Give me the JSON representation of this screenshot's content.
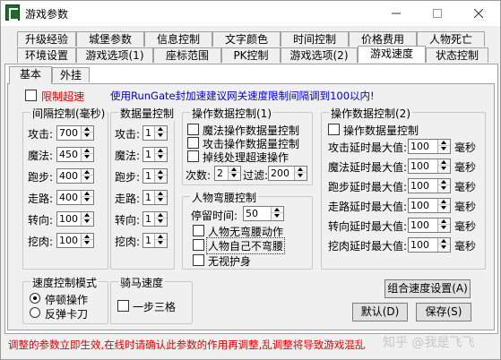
{
  "window": {
    "title": "游戏参数",
    "minimize": "—",
    "maximize": "□",
    "close": "✕"
  },
  "tabs_row1": [
    "升级经验",
    "城堡参数",
    "信息控制",
    "文字颜色",
    "时间控制",
    "价格费用",
    "人物死亡"
  ],
  "tabs_row2": [
    "环境设置",
    "游戏选项(1)",
    "座标范围",
    "PK控制",
    "游戏选项(2)",
    "游戏速度",
    "状态控制"
  ],
  "active_tab": "游戏速度",
  "subtabs": [
    "基本",
    "外挂"
  ],
  "limit_speed": {
    "label": "限制超速",
    "checked": false
  },
  "notice": "使用RunGate封加速建议网关速度限制间隔调到100以内!",
  "interval_group": {
    "title": "间隔控制(毫秒)",
    "rows": [
      {
        "label": "攻击:",
        "value": "700"
      },
      {
        "label": "魔法:",
        "value": "450"
      },
      {
        "label": "跑步:",
        "value": "400"
      },
      {
        "label": "走路:",
        "value": "400"
      },
      {
        "label": "转向:",
        "value": "100"
      },
      {
        "label": "挖肉:",
        "value": "100"
      }
    ]
  },
  "count_group": {
    "title": "数据量控制",
    "rows": [
      {
        "label": "攻击:",
        "value": "1"
      },
      {
        "label": "魔法:",
        "value": "1"
      },
      {
        "label": "跑步:",
        "value": "1"
      },
      {
        "label": "走路:",
        "value": "1"
      },
      {
        "label": "转向:",
        "value": "1"
      },
      {
        "label": "挖肉:",
        "value": "1"
      }
    ]
  },
  "op1_group": {
    "title": "操作数据控制(1)",
    "checks": [
      "魔法操作数据量控制",
      "攻击操作数据量控制",
      "掉线处理超速操作"
    ],
    "count_label": "次数:",
    "count_value": "2",
    "filter_label": "过滤:",
    "filter_value": "200"
  },
  "bow_group": {
    "title": "人物弯腰控制",
    "stay_label": "停留时间:",
    "stay_value": "50",
    "checks": [
      "人物无弯腰动作",
      "人物自己不弯腰",
      "无视护身"
    ]
  },
  "op2_group": {
    "title": "操作数据控制(2)",
    "check": "操作数据量控制",
    "unit": "毫秒",
    "rows": [
      {
        "label": "攻击延时最大值:",
        "value": "100"
      },
      {
        "label": "魔法延时最大值:",
        "value": "100"
      },
      {
        "label": "跑步延时最大值:",
        "value": "100"
      },
      {
        "label": "走路延时最大值:",
        "value": "100"
      },
      {
        "label": "转向延时最大值:",
        "value": "100"
      },
      {
        "label": "挖肉延时最大值:",
        "value": "100"
      }
    ]
  },
  "speed_mode_group": {
    "title": "速度控制模式",
    "options": [
      "停顿操作",
      "反弹卡刀"
    ],
    "selected": 0
  },
  "horse_group": {
    "title": "骑马速度",
    "check": "一步三格"
  },
  "buttons": {
    "combo": "组合速度设置(A)",
    "default": "默认(D)",
    "save": "保存(S)"
  },
  "footer": "调整的参数立即生效,在线时请确认此参数的作用再调整,乱调整将导致游戏混乱",
  "watermark": "知乎 @我是飞飞"
}
